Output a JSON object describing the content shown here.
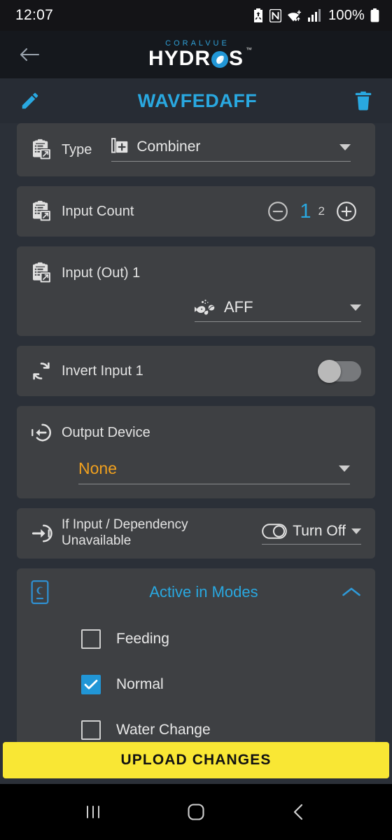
{
  "status_bar": {
    "time": "12:07",
    "battery_percent": "100%",
    "icons": [
      "battery-saver-icon",
      "nfc-icon",
      "wifi-icon",
      "cellular-signal-icon",
      "battery-icon"
    ]
  },
  "app_header": {
    "back_icon": "back-arrow-icon",
    "brand_top": "CORALVUE",
    "brand_main_left": "HYDR",
    "brand_main_right": "S",
    "trademark": "™"
  },
  "title_bar": {
    "edit_icon": "pencil-icon",
    "title": "WAVFEDAFF",
    "delete_icon": "trash-icon",
    "title_color": "#29a8e0"
  },
  "form": {
    "type": {
      "label": "Type",
      "icon": "clipboard-edit-icon",
      "value": "Combiner",
      "value_icon": "combiner-add-icon"
    },
    "input_count": {
      "label": "Input Count",
      "icon": "clipboard-edit-icon",
      "decrement_icon": "minus-circle-icon",
      "current": "1",
      "total": "2",
      "increment_icon": "plus-circle-icon",
      "current_color": "#29a8e0"
    },
    "input_out": {
      "label": "Input (Out) 1",
      "icon": "clipboard-edit-icon",
      "value": "AFF",
      "value_icon": "fish-bubbles-icon"
    },
    "invert_input": {
      "label": "Invert Input 1",
      "icon": "invert-refresh-icon",
      "toggle_state": "off"
    },
    "output_device": {
      "label": "Output Device",
      "icon": "output-arrow-icon",
      "value": "None",
      "value_color": "#f0a01e"
    },
    "dependency": {
      "label_line1": "If Input / Dependency",
      "label_line2": "Unavailable",
      "icon": "input-arrow-icon",
      "value": "Turn Off",
      "value_icon": "toggle-outline-icon"
    },
    "active_modes": {
      "title": "Active in Modes",
      "icon": "device-mode-icon",
      "collapse_icon": "chevron-up-icon",
      "title_color": "#29a8e0",
      "modes": [
        {
          "label": "Feeding",
          "checked": false
        },
        {
          "label": "Normal",
          "checked": true
        },
        {
          "label": "Water Change",
          "checked": false
        }
      ]
    }
  },
  "footer": {
    "upload_label": "UPLOAD CHANGES",
    "upload_color": "#f9e734"
  },
  "nav_bar": {
    "recents_icon": "recents-icon",
    "home_icon": "home-icon",
    "back_icon": "back-chevron-icon"
  }
}
